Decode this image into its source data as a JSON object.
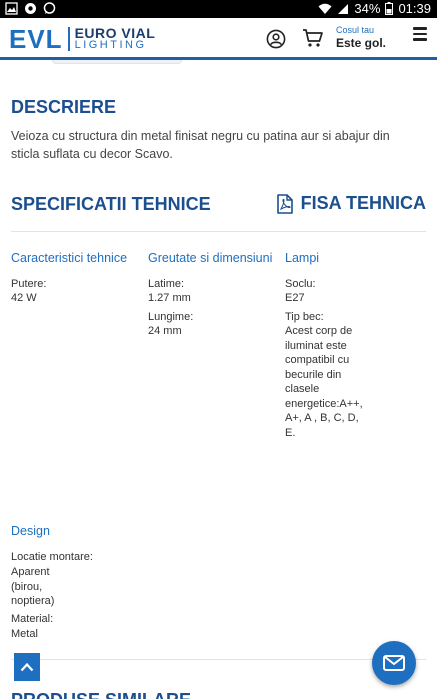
{
  "status_bar": {
    "battery": "34%",
    "time": "01:39"
  },
  "header": {
    "logo_mark": "EVL",
    "logo_line1": "EURO VIAL",
    "logo_line2": "LIGHTING",
    "cart_label": "Cosul tau",
    "cart_status": "Este gol."
  },
  "description": {
    "title": "DESCRIERE",
    "text": "Veioza cu structura din metal finisat negru cu patina aur si abajur din sticla suflata cu decor Scavo."
  },
  "specs": {
    "title": "SPECIFICATII TEHNICE",
    "fisa_label": "FISA TEHNICA",
    "columns": {
      "tech": {
        "heading": "Caracteristici tehnice",
        "items": [
          {
            "label": "Putere:",
            "value": "42 W"
          }
        ]
      },
      "weight": {
        "heading": "Greutate si dimensiuni",
        "items": [
          {
            "label": "Latime:",
            "value": "1.27 mm"
          },
          {
            "label": "Lungime:",
            "value": "24 mm"
          }
        ]
      },
      "lamps": {
        "heading": "Lampi",
        "items": [
          {
            "label": "Soclu:",
            "value": "E27"
          },
          {
            "label": "Tip bec:",
            "value": "Acest corp de iluminat este compatibil cu becurile din clasele energetice:A++, A+, A , B, C, D, E."
          }
        ]
      }
    },
    "design": {
      "heading": "Design",
      "items": [
        {
          "label": "Locatie montare:",
          "value": "Aparent (birou, noptiera)"
        },
        {
          "label": "Material:",
          "value": "Metal"
        }
      ]
    }
  },
  "similar_title": "PRODUSE SIMILARE",
  "colors": {
    "brand_blue": "#1e6fc0",
    "heading_blue": "#1b4f8f"
  }
}
